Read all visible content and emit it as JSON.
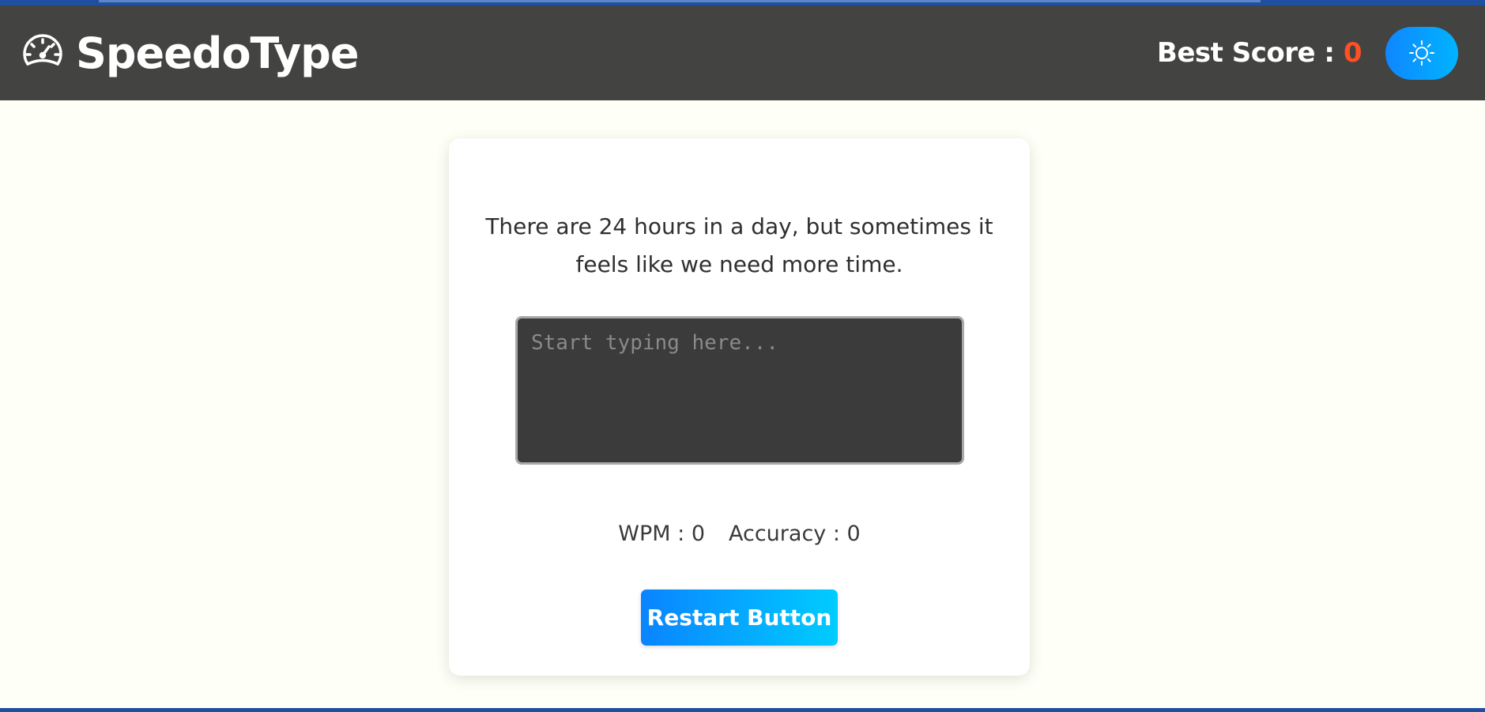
{
  "header": {
    "brand_icon": "speedometer-icon",
    "brand_name": "SpeedoType",
    "best_score_label": "Best Score : ",
    "best_score_value": "0",
    "theme_toggle_icon": "sun-icon",
    "colors": {
      "navbar_bg": "#434341",
      "score_accent": "#ff4f25",
      "toggle_gradient_start": "#0f86ff",
      "toggle_gradient_end": "#00b4ff"
    }
  },
  "card": {
    "quote": "There are 24 hours in a day, but sometimes it feels like we need more time.",
    "typing_area": {
      "value": "",
      "placeholder": "Start typing here..."
    },
    "stats": {
      "wpm": "WPM : 0",
      "accuracy": "Accuracy : 0"
    },
    "restart_label": "Restart Button"
  }
}
